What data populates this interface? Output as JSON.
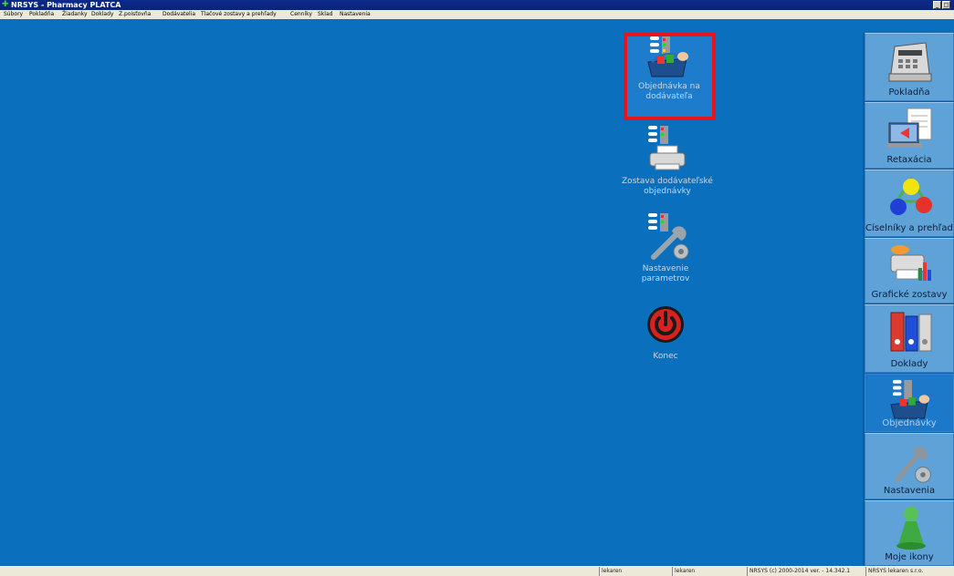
{
  "titlebar": {
    "title": "NRSYS - Pharmacy PLATCA",
    "minimize": "_",
    "maximize": "□"
  },
  "menu": [
    "Súbory",
    "Pokladňa",
    "Žiadanky",
    "Doklady",
    "Z.poisťovňa",
    "Dodávatelia",
    "Tlačové zostavy a prehľady",
    "Cenníky",
    "Sklad",
    "Nastavenia"
  ],
  "desktop": {
    "items": [
      {
        "line1": "Objednávka na",
        "line2": "dodávateľa"
      },
      {
        "line1": "Zostava dodávateľské",
        "line2": "objednávky"
      },
      {
        "line1": "Nastavenie",
        "line2": "parametrov"
      },
      {
        "line1": "Konec",
        "line2": ""
      }
    ]
  },
  "toolbar": {
    "buttons": [
      {
        "label": "Pokladňa"
      },
      {
        "label": "Retaxácia"
      },
      {
        "label": "Číselníky a prehľady"
      },
      {
        "label": "Grafické zostavy"
      },
      {
        "label": "Doklady"
      },
      {
        "label": "Objednávky"
      },
      {
        "label": "Nastavenia"
      },
      {
        "label": "Moje ikony"
      }
    ]
  },
  "statusbar": {
    "cells": [
      "lekaren",
      "lekaren",
      "NRSYS (c) 2000-2014 ver. - 14.342.1",
      "NRSYS lekaren s.r.o."
    ]
  },
  "colors": {
    "desktop": "#0a6fbd",
    "highlight": "#e8141c",
    "toolbar": "#5ea2d8"
  }
}
